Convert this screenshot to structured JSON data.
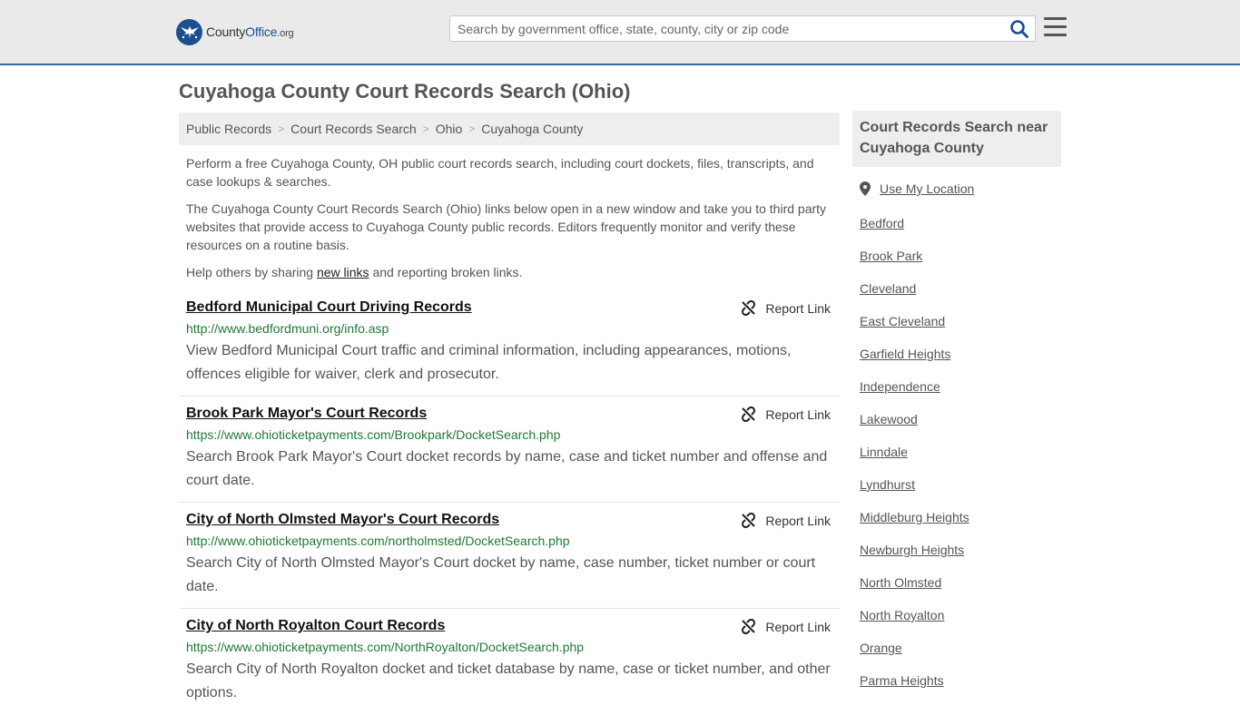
{
  "header": {
    "logo_county": "County",
    "logo_office": "Office",
    "logo_org": ".org",
    "search_placeholder": "Search by government office, state, county, city or zip code"
  },
  "page": {
    "title": "Cuyahoga County Court Records Search (Ohio)"
  },
  "breadcrumb": [
    "Public Records",
    "Court Records Search",
    "Ohio",
    "Cuyahoga County"
  ],
  "intro": {
    "p1": "Perform a free Cuyahoga County, OH public court records search, including court dockets, files, transcripts, and case lookups & searches.",
    "p2": "The Cuyahoga County Court Records Search (Ohio) links below open in a new window and take you to third party websites that provide access to Cuyahoga County public records. Editors frequently monitor and verify these resources on a routine basis.",
    "p3_before": "Help others by sharing ",
    "p3_link": "new links",
    "p3_after": " and reporting broken links."
  },
  "results": [
    {
      "title": "Bedford Municipal Court Driving Records",
      "url": "http://www.bedfordmuni.org/info.asp",
      "desc": "View Bedford Municipal Court traffic and criminal information, including appearances, motions, offences eligible for waiver, clerk and prosecutor.",
      "report": "Report Link"
    },
    {
      "title": "Brook Park Mayor's Court Records",
      "url": "https://www.ohioticketpayments.com/Brookpark/DocketSearch.php",
      "desc": "Search Brook Park Mayor's Court docket records by name, case and ticket number and offense and court date.",
      "report": "Report Link"
    },
    {
      "title": "City of North Olmsted Mayor's Court Records",
      "url": "http://www.ohioticketpayments.com/northolmsted/DocketSearch.php",
      "desc": "Search City of North Olmsted Mayor's Court docket by name, case number, ticket number or court date.",
      "report": "Report Link"
    },
    {
      "title": "City of North Royalton Court Records",
      "url": "https://www.ohioticketpayments.com/NorthRoyalton/DocketSearch.php",
      "desc": "Search City of North Royalton docket and ticket database by name, case or ticket number, and other options.",
      "report": "Report Link"
    }
  ],
  "sidebar": {
    "heading": "Court Records Search near Cuyahoga County",
    "use_location": "Use My Location",
    "places": [
      "Bedford",
      "Brook Park",
      "Cleveland",
      "East Cleveland",
      "Garfield Heights",
      "Independence",
      "Lakewood",
      "Linndale",
      "Lyndhurst",
      "Middleburg Heights",
      "Newburgh Heights",
      "North Olmsted",
      "North Royalton",
      "Orange",
      "Parma Heights"
    ]
  },
  "colors": {
    "brand_blue": "#1b4f8f",
    "url_green": "#1f7a35",
    "header_border": "#2f6aa7"
  }
}
